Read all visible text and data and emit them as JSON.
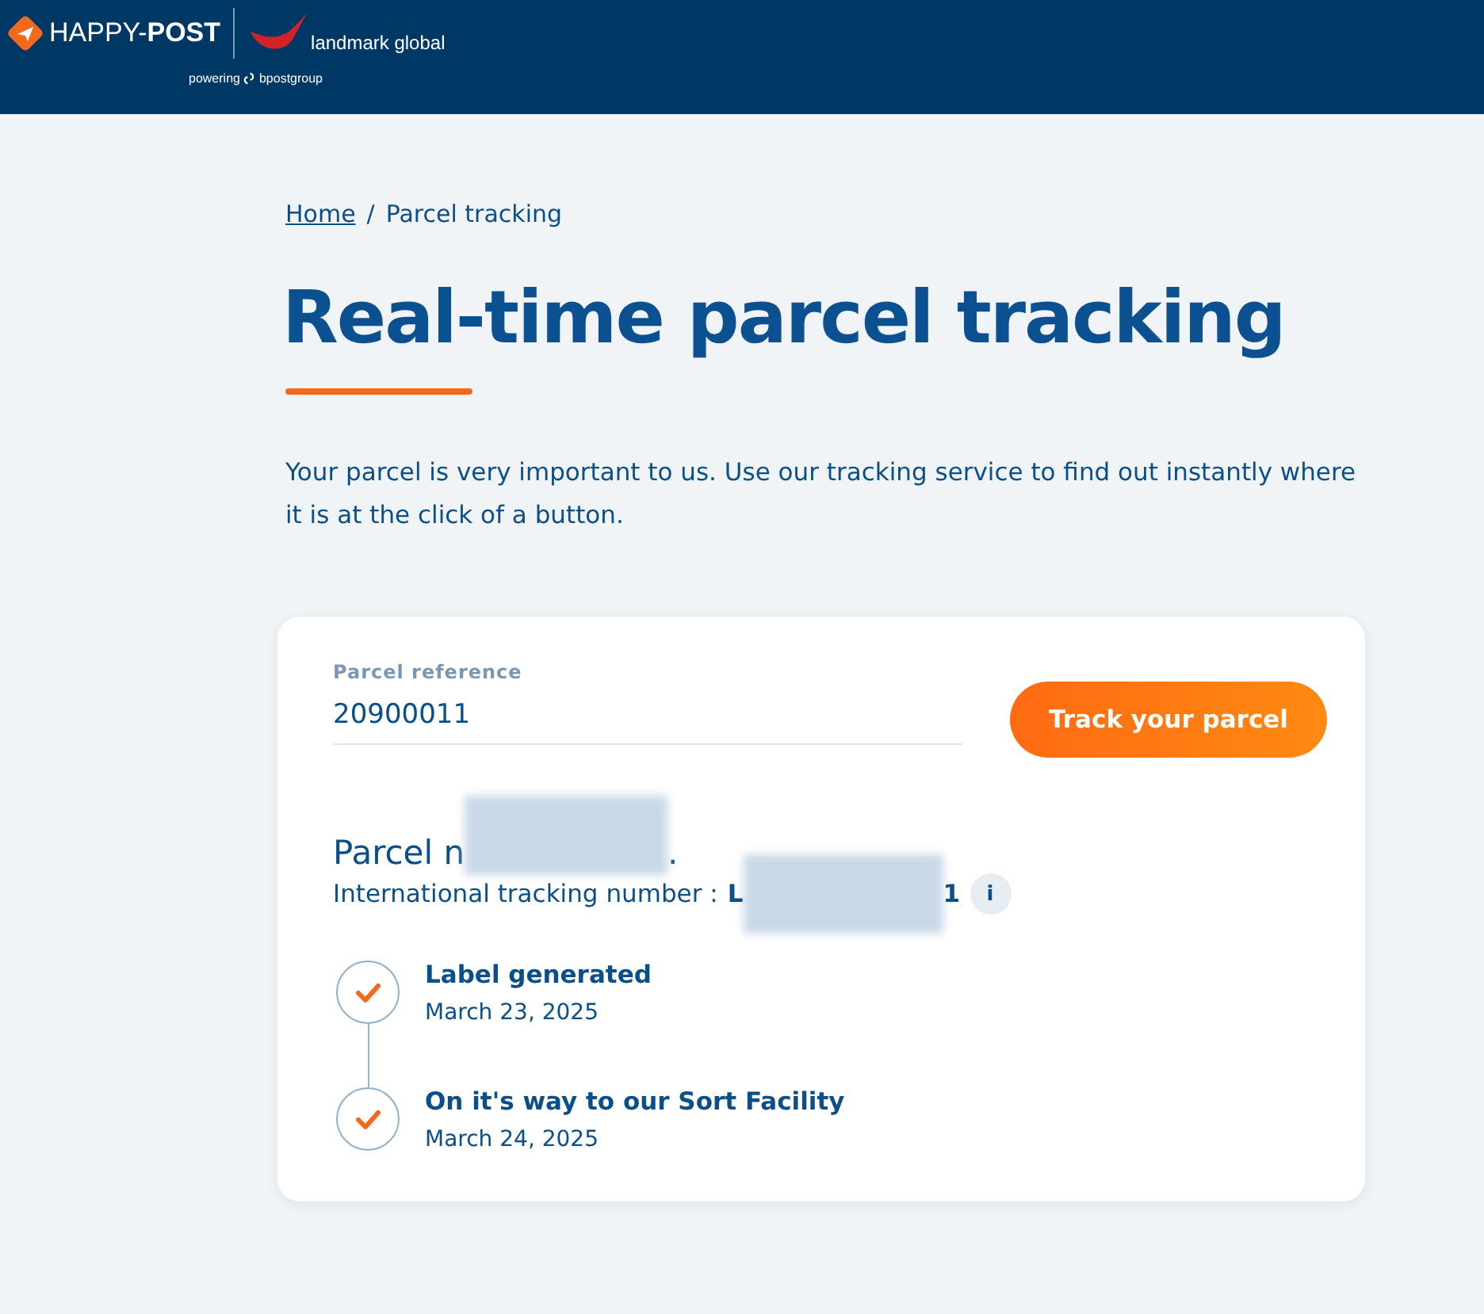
{
  "header": {
    "brand": "HAPPY-",
    "brand_bold": "POST",
    "partner": "landmark global",
    "tagline": "powering",
    "group": "bpostgroup"
  },
  "breadcrumb_separator": "/",
  "breadcrumb": [
    {
      "label": "Home",
      "link": true
    },
    {
      "label": "Parcel tracking",
      "link": false
    }
  ],
  "title": "Real-time parcel tracking",
  "intro": "Your parcel is very important to us. Use our tracking service to find out instantly where it is at the click of a button.",
  "form": {
    "label": "Parcel reference",
    "value": "20900011",
    "button": "Track your parcel"
  },
  "parcel": {
    "heading_start": "Parcel n",
    "heading_end": ".",
    "tracking_label": "International tracking number :",
    "tracking_start": "L",
    "tracking_end": "1",
    "info": "i"
  },
  "steps": [
    {
      "title": "Label generated",
      "date": "March 23, 2025",
      "done": true
    },
    {
      "title": "On it's way to our Sort Facility",
      "date": "March 24, 2025",
      "done": true
    }
  ]
}
